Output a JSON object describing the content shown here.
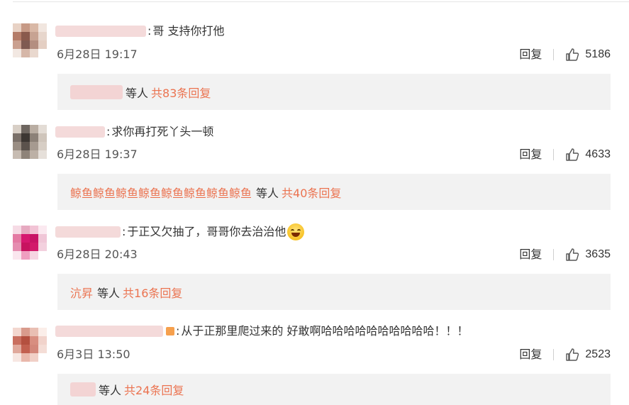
{
  "colors": {
    "link": "#eb7350",
    "reply_bg": "#f2f2f2",
    "text": "#333333",
    "meta": "#555555"
  },
  "comments": [
    {
      "text": "哥 支持你打他",
      "time": "6月28日 19:17",
      "reply_label": "回复",
      "like_icon": "thumbs-up-icon",
      "likes": "5186",
      "replies_names": "",
      "replies_etc": "等人",
      "replies_total": "共83条回复",
      "avatar_colors": [
        "#e8d2c5",
        "#c79a86",
        "#d9b8a6",
        "#f1e6df",
        "#b47c68",
        "#8a5a4d",
        "#c7a392",
        "#e7d6cc",
        "#caa08f",
        "#7f5a51",
        "#b48e80",
        "#e4cfc3",
        "#f2e8e2",
        "#d6b7a8",
        "#e9d8ce",
        "#ffffff"
      ]
    },
    {
      "text": "求你再打死丫头一顿",
      "time": "6月28日 19:37",
      "reply_label": "回复",
      "like_icon": "thumbs-up-icon",
      "likes": "4633",
      "replies_names": "鲸鱼鲸鱼鲸鱼鲸鱼鲸鱼鲸鱼鲸鱼鲸鱼",
      "replies_etc": "等人",
      "replies_total": "共40条回复",
      "avatar_colors": [
        "#d8cfc6",
        "#6e6660",
        "#b9ada2",
        "#e3dcd5",
        "#7a7069",
        "#3d3733",
        "#8c8178",
        "#cfc5bb",
        "#9a8e84",
        "#5b524c",
        "#a69a90",
        "#d7cec5",
        "#c7bcb2",
        "#8e8379",
        "#bcb0a5",
        "#e6e0da"
      ]
    },
    {
      "text": "于正又欠抽了，哥哥你去治治他",
      "time": "6月28日 20:43",
      "reply_label": "回复",
      "like_icon": "thumbs-up-icon",
      "likes": "3635",
      "replies_names": "沆昇",
      "replies_etc": "等人",
      "replies_total": "共16条回复",
      "emoji": "laughing-emoji-icon",
      "avatar_colors": [
        "#f6dbe5",
        "#e6a9c0",
        "#f2c3d5",
        "#fbe9f0",
        "#e47aa3",
        "#d6176f",
        "#c81466",
        "#f0c6d7",
        "#e58db0",
        "#c7125f",
        "#d21a6b",
        "#f3d0de",
        "#fae6ee",
        "#ef9fc0",
        "#f6d5e2",
        "#ffffff"
      ]
    },
    {
      "text": "从于正那里爬过来的 好敢啊哈哈哈哈哈哈哈哈哈哈！！！",
      "time": "6月3日 13:50",
      "reply_label": "回复",
      "like_icon": "thumbs-up-icon",
      "likes": "2523",
      "replies_names": "",
      "replies_etc": "等人",
      "replies_total": "共24条回复",
      "avatar_colors": [
        "#f3d7cf",
        "#d99b8c",
        "#e9bfb3",
        "#fbeee9",
        "#c96f5f",
        "#b4503f",
        "#d88e80",
        "#f1d3cb",
        "#e0a99c",
        "#c2604f",
        "#d3877a",
        "#f4ddd6",
        "#f7e7e2",
        "#e9b8ab",
        "#f1d0c7",
        "#ffffff"
      ]
    }
  ]
}
